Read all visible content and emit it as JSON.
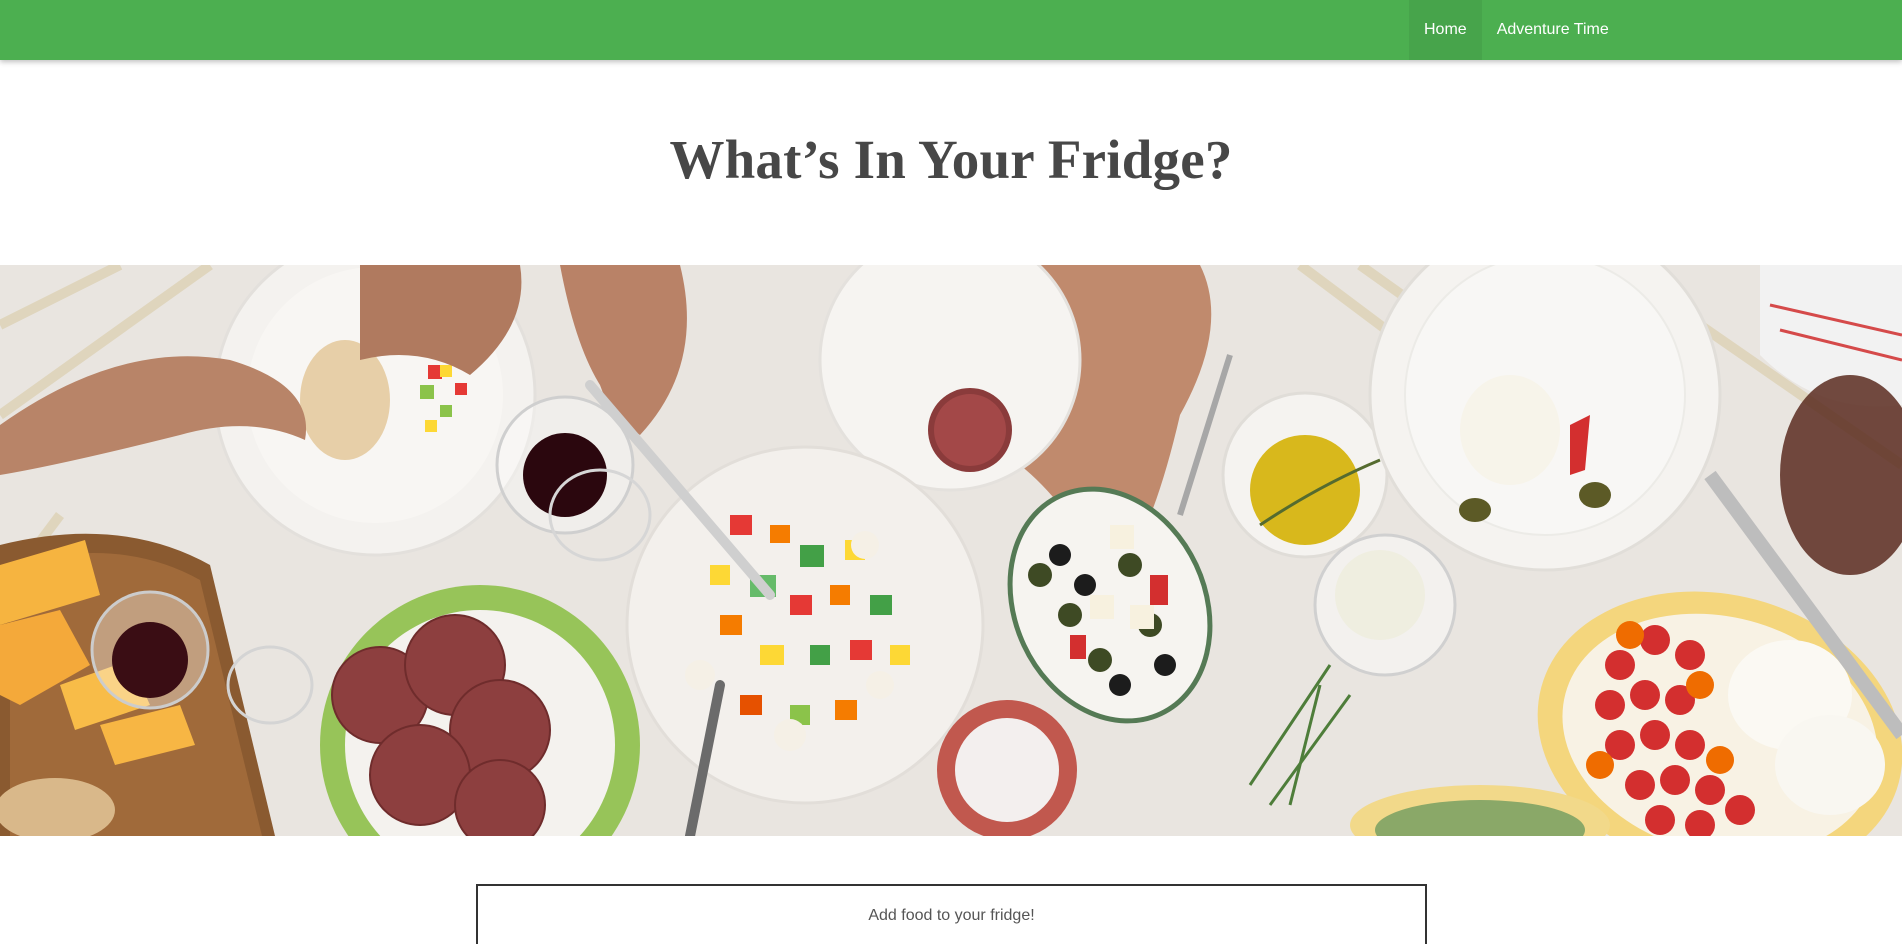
{
  "nav": {
    "items": [
      {
        "label": "Home",
        "active": true
      },
      {
        "label": "Adventure Time",
        "active": false
      }
    ],
    "background": "#4caf50"
  },
  "header": {
    "title": "What’s In Your Fridge?"
  },
  "hero": {
    "image": "food-table-photo"
  },
  "add_food": {
    "label": "Add food to your fridge!"
  }
}
